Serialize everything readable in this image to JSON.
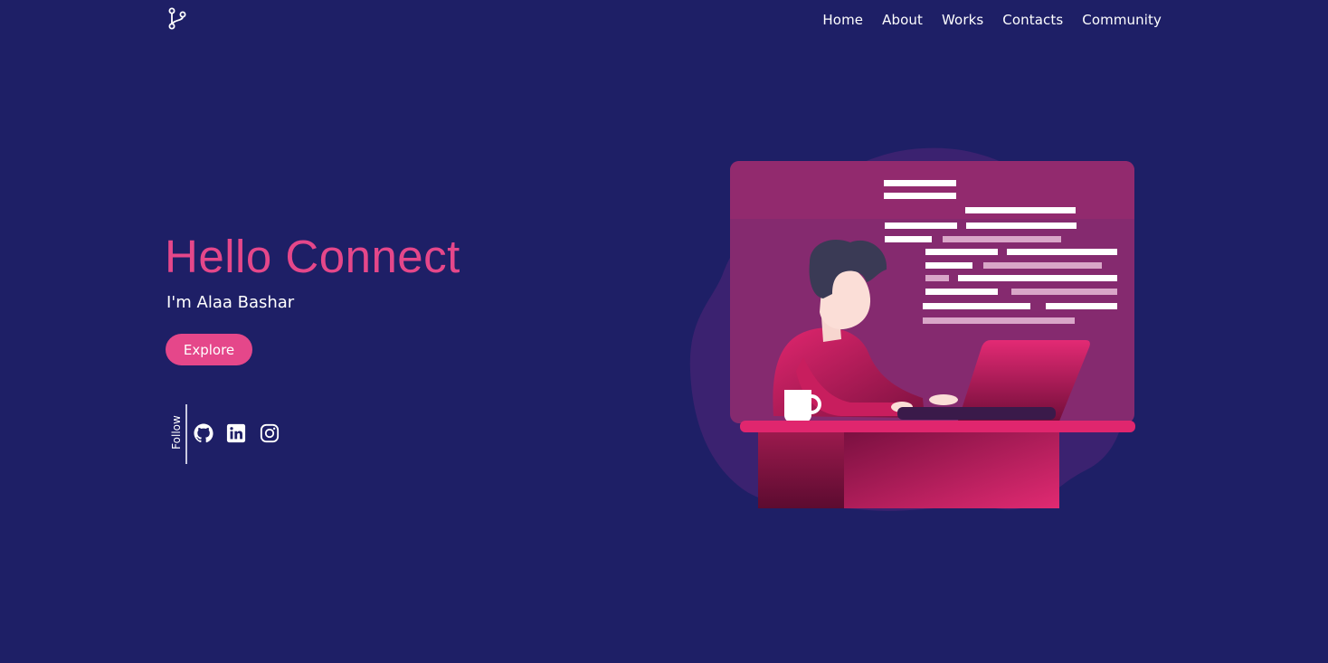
{
  "header": {
    "logo_icon": "git-branch-icon",
    "nav": [
      {
        "label": "Home"
      },
      {
        "label": "About"
      },
      {
        "label": "Works"
      },
      {
        "label": "Contacts"
      },
      {
        "label": "Community"
      }
    ]
  },
  "hero": {
    "title": "Hello Connect",
    "subtitle": "I'm Alaa Bashar",
    "cta_label": "Explore"
  },
  "follow": {
    "label": "Follow",
    "links": [
      {
        "icon": "github-icon"
      },
      {
        "icon": "linkedin-icon"
      },
      {
        "icon": "instagram-icon"
      }
    ]
  },
  "illustration": {
    "icon": "developer-at-laptop-illustration"
  },
  "colors": {
    "background": "#1e1f66",
    "accent": "#e5478a",
    "panel": "#8e2a6f",
    "text": "#ffffff"
  }
}
